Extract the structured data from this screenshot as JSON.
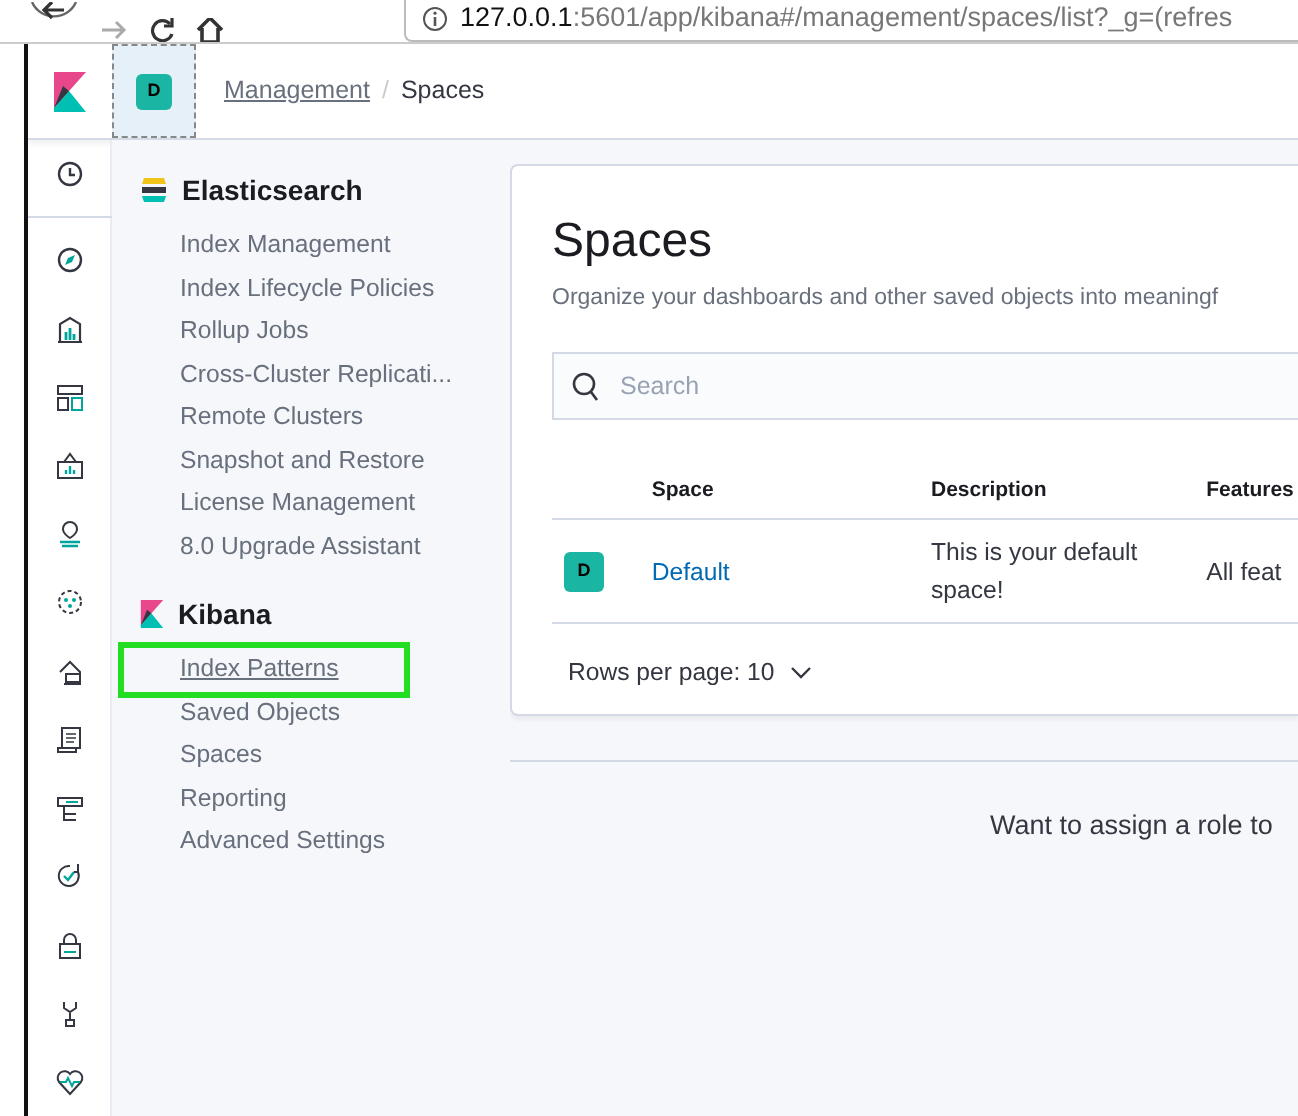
{
  "browser": {
    "url_host": "127.0.0.1",
    "url_rest": ":5601/app/kibana#/management/spaces/list?_g=(refres"
  },
  "header": {
    "space_badge": "D",
    "separator": "/",
    "breadcrumbs": [
      {
        "label": "Management",
        "current": false
      },
      {
        "label": "Spaces",
        "current": true
      }
    ]
  },
  "sidebar": {
    "sections": [
      {
        "title": "Elasticsearch",
        "kind": "elasticsearch",
        "items": [
          {
            "label": "Index Management",
            "highlighted": false
          },
          {
            "label": "Index Lifecycle Policies",
            "highlighted": false
          },
          {
            "label": "Rollup Jobs",
            "highlighted": false
          },
          {
            "label": "Cross-Cluster Replicati...",
            "highlighted": false
          },
          {
            "label": "Remote Clusters",
            "highlighted": false
          },
          {
            "label": "Snapshot and Restore",
            "highlighted": false
          },
          {
            "label": "License Management",
            "highlighted": false
          },
          {
            "label": "8.0 Upgrade Assistant",
            "highlighted": false
          }
        ]
      },
      {
        "title": "Kibana",
        "kind": "kibana",
        "items": [
          {
            "label": "Index Patterns",
            "highlighted": true
          },
          {
            "label": "Saved Objects",
            "highlighted": false
          },
          {
            "label": "Spaces",
            "highlighted": false
          },
          {
            "label": "Reporting",
            "highlighted": false
          },
          {
            "label": "Advanced Settings",
            "highlighted": false
          }
        ]
      }
    ]
  },
  "panel": {
    "title": "Spaces",
    "subtitle": "Organize your dashboards and other saved objects into meaningf",
    "search": {
      "placeholder": "Search"
    },
    "table": {
      "columns": [
        "Space",
        "Description",
        "Features"
      ],
      "rows": [
        {
          "badge": "D",
          "color": "#1bb5a3",
          "space": "Default",
          "description": "This is your default space!",
          "features": "All feat"
        }
      ]
    },
    "pager": "Rows per page: 10"
  },
  "footer_text": "Want to assign a role to"
}
